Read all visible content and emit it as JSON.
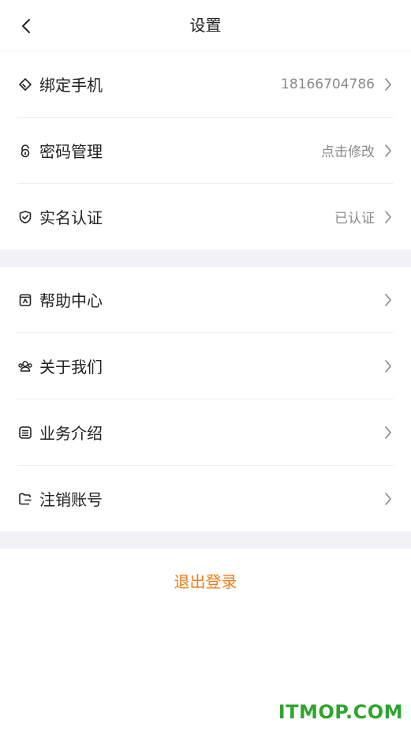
{
  "header": {
    "title": "设置",
    "back_icon": "chevron-left-icon"
  },
  "group1": [
    {
      "label": "绑定手机",
      "value": "18166704786",
      "icon": "tag-icon"
    },
    {
      "label": "密码管理",
      "value": "点击修改",
      "icon": "lock-icon"
    },
    {
      "label": "实名认证",
      "value": "已认证",
      "icon": "shield-check-icon"
    }
  ],
  "group2": [
    {
      "label": "帮助中心",
      "icon": "help-book-icon"
    },
    {
      "label": "关于我们",
      "icon": "group-icon"
    },
    {
      "label": "业务介绍",
      "icon": "list-icon"
    },
    {
      "label": "注销账号",
      "icon": "folder-logout-icon"
    }
  ],
  "logout": {
    "label": "退出登录"
  },
  "watermark": "ITMOP.COM",
  "colors": {
    "accent": "#f07a12",
    "separator": "#f1f2f6",
    "watermark": "#2ea52e"
  }
}
